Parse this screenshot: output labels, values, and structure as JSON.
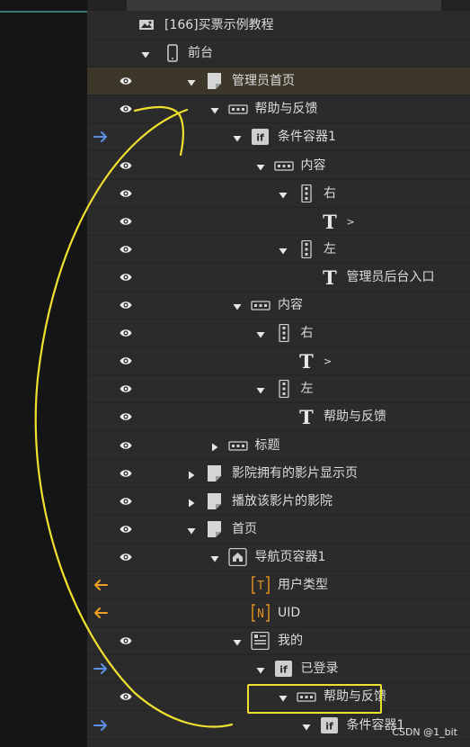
{
  "colors": {
    "accent_yellow": "#f0e030",
    "arrow_blue": "#5b8fe8",
    "arrow_orange": "#f0a020",
    "selected_row": "#3d372a",
    "panel_bg": "#2b2b2b"
  },
  "tree": {
    "rows": [
      {
        "label": "[166]买票示例教程",
        "icon": "image-icon",
        "depth": 0,
        "toggle": "none",
        "gutter": "none"
      },
      {
        "label": "前台",
        "icon": "phone-icon",
        "depth": 0,
        "toggle": "expanded",
        "gutter": "none"
      },
      {
        "label": "管理员首页",
        "icon": "page-icon",
        "depth": 1,
        "toggle": "expanded",
        "gutter": "eye",
        "selected": true
      },
      {
        "label": "帮助与反馈",
        "icon": "row-container-icon",
        "depth": 2,
        "toggle": "expanded",
        "gutter": "eye"
      },
      {
        "label": "条件容器1",
        "icon": "if-icon",
        "depth": 3,
        "toggle": "expanded",
        "gutter": "arrow-right"
      },
      {
        "label": "内容",
        "icon": "row-container-icon",
        "depth": 4,
        "toggle": "expanded",
        "gutter": "eye"
      },
      {
        "label": "右",
        "icon": "column-container-icon",
        "depth": 5,
        "toggle": "expanded",
        "gutter": "eye"
      },
      {
        "label": ">",
        "icon": "text-icon",
        "depth": 6,
        "toggle": "none",
        "gutter": "eye"
      },
      {
        "label": "左",
        "icon": "column-container-icon",
        "depth": 5,
        "toggle": "expanded",
        "gutter": "eye"
      },
      {
        "label": "管理员后台入口",
        "icon": "text-icon",
        "depth": 6,
        "toggle": "none",
        "gutter": "eye"
      },
      {
        "label": "内容",
        "icon": "row-container-icon",
        "depth": 3,
        "toggle": "expanded",
        "gutter": "eye"
      },
      {
        "label": "右",
        "icon": "column-container-icon",
        "depth": 4,
        "toggle": "expanded",
        "gutter": "eye"
      },
      {
        "label": ">",
        "icon": "text-icon",
        "depth": 5,
        "toggle": "none",
        "gutter": "eye"
      },
      {
        "label": "左",
        "icon": "column-container-icon",
        "depth": 4,
        "toggle": "expanded",
        "gutter": "eye"
      },
      {
        "label": "帮助与反馈",
        "icon": "text-icon",
        "depth": 5,
        "toggle": "none",
        "gutter": "eye"
      },
      {
        "label": "标题",
        "icon": "row-container-icon",
        "depth": 2,
        "toggle": "collapsed",
        "gutter": "eye"
      },
      {
        "label": "影院拥有的影片显示页",
        "icon": "page-icon",
        "depth": 1,
        "toggle": "collapsed",
        "gutter": "eye"
      },
      {
        "label": "播放该影片的影院",
        "icon": "page-icon",
        "depth": 1,
        "toggle": "collapsed",
        "gutter": "eye"
      },
      {
        "label": "首页",
        "icon": "page-icon",
        "depth": 1,
        "toggle": "expanded",
        "gutter": "eye"
      },
      {
        "label": "导航页容器1",
        "icon": "home-icon",
        "depth": 2,
        "toggle": "expanded",
        "gutter": "eye"
      },
      {
        "label": "用户类型",
        "icon": "variable-t-icon",
        "depth": 3,
        "toggle": "none",
        "gutter": "arrow-left"
      },
      {
        "label": "UID",
        "icon": "variable-n-icon",
        "depth": 3,
        "toggle": "none",
        "gutter": "arrow-left"
      },
      {
        "label": "我的",
        "icon": "user-page-icon",
        "depth": 3,
        "toggle": "expanded",
        "gutter": "eye"
      },
      {
        "label": "已登录",
        "icon": "if-icon",
        "depth": 4,
        "toggle": "expanded",
        "gutter": "arrow-right"
      },
      {
        "label": "帮助与反馈",
        "icon": "row-container-icon",
        "depth": 5,
        "toggle": "expanded",
        "gutter": "eye"
      },
      {
        "label": "条件容器1",
        "icon": "if-icon",
        "depth": 6,
        "toggle": "expanded",
        "gutter": "arrow-right"
      }
    ]
  },
  "watermark": "CSDN @1_bit"
}
